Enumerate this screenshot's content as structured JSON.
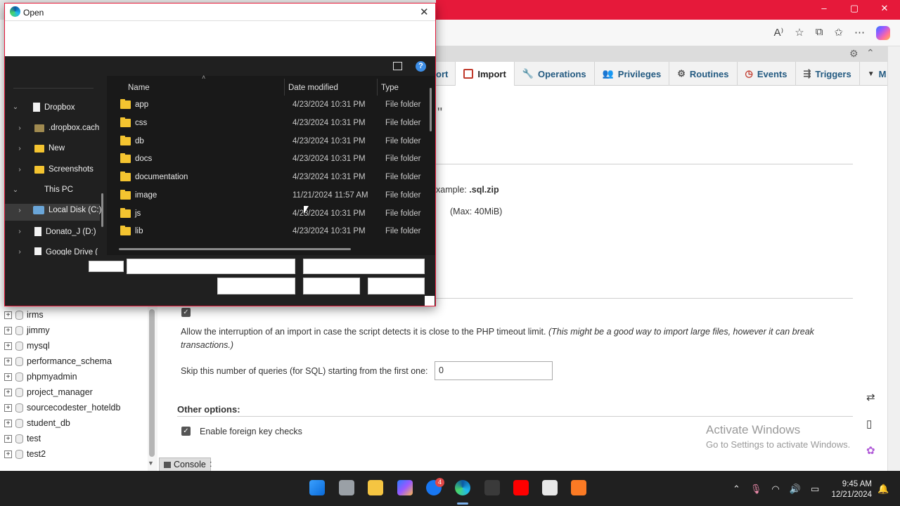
{
  "dialog": {
    "title": "Open",
    "columns": {
      "name": "Name",
      "date": "Date modified",
      "type": "Type"
    },
    "tree": [
      {
        "label": "Dropbox",
        "kind": "doc",
        "expand": "open"
      },
      {
        "label": ".dropbox.cach",
        "kind": "folder-dark",
        "expand": "closed"
      },
      {
        "label": "New",
        "kind": "folder",
        "expand": "closed"
      },
      {
        "label": "Screenshots",
        "kind": "folder",
        "expand": "closed"
      },
      {
        "label": "This PC",
        "kind": "none",
        "expand": "open"
      },
      {
        "label": "Local Disk (C:)",
        "kind": "drive",
        "expand": "closed"
      },
      {
        "label": "Donato_J (D:)",
        "kind": "doc",
        "expand": "closed"
      },
      {
        "label": "Google Drive (",
        "kind": "doc",
        "expand": "closed"
      }
    ],
    "files": [
      {
        "name": "app",
        "date": "4/23/2024 10:31 PM",
        "type": "File folder"
      },
      {
        "name": "css",
        "date": "4/23/2024 10:31 PM",
        "type": "File folder"
      },
      {
        "name": "db",
        "date": "4/23/2024 10:31 PM",
        "type": "File folder"
      },
      {
        "name": "docs",
        "date": "4/23/2024 10:31 PM",
        "type": "File folder"
      },
      {
        "name": "documentation",
        "date": "4/23/2024 10:31 PM",
        "type": "File folder"
      },
      {
        "name": "image",
        "date": "11/21/2024 11:57 AM",
        "type": "File folder"
      },
      {
        "name": "js",
        "date": "4/23/2024 10:31 PM",
        "type": "File folder"
      },
      {
        "name": "lib",
        "date": "4/23/2024 10:31 PM",
        "type": "File folder"
      }
    ],
    "help_icon": "?",
    "close_icon": "✕"
  },
  "pma": {
    "tabs": [
      {
        "label": "ort",
        "icon": "export-icon",
        "active": false
      },
      {
        "label": "Import",
        "icon": "import-icon",
        "active": true
      },
      {
        "label": "Operations",
        "icon": "wrench-icon",
        "active": false
      },
      {
        "label": "Privileges",
        "icon": "users-icon",
        "active": false
      },
      {
        "label": "Routines",
        "icon": "routines-icon",
        "active": false
      },
      {
        "label": "Events",
        "icon": "clock-icon",
        "active": false
      },
      {
        "label": "Triggers",
        "icon": "triggers-icon",
        "active": false
      },
      {
        "label": "M",
        "icon": "more-icon",
        "active": false
      }
    ],
    "quote_fragment": "\"",
    "example_text": "xample:",
    "example_ext": ".sql.zip",
    "max_text": "(Max: 40MiB)",
    "allow_interrupt": "Allow the interruption of an import in case the script detects it is close to the PHP timeout limit.",
    "allow_interrupt_note_1": "(This might be a good way to import large files, however it can break",
    "allow_interrupt_note_2": "transactions.)",
    "skip_label": "Skip this number of queries (for SQL) starting from the first one:",
    "skip_value": "0",
    "other_options": "Other options:",
    "foreign_key": "Enable foreign key checks",
    "console": "Console",
    "console_tail": ":"
  },
  "databases": [
    "irms",
    "jimmy",
    "mysql",
    "performance_schema",
    "phpmyadmin",
    "project_manager",
    "sourcecodester_hoteldb",
    "student_db",
    "test",
    "test2"
  ],
  "activate": {
    "line1": "Activate Windows",
    "line2": "Go to Settings to activate Windows."
  },
  "taskbar": {
    "badge": "4",
    "time": "9:45 AM",
    "date": "12/21/2024"
  },
  "colors": {
    "accent_red": "#e6193a",
    "pma_link": "#235a81",
    "dialog_bg": "#202020"
  }
}
